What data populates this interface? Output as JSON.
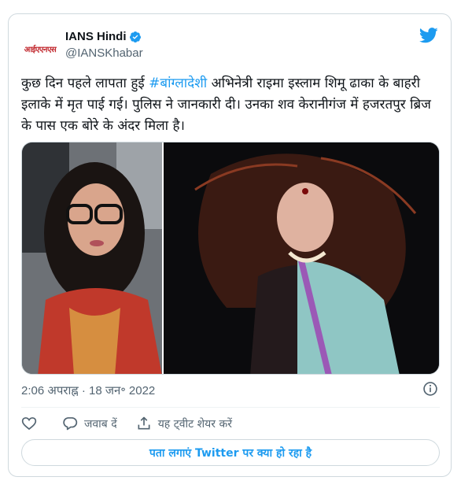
{
  "author": {
    "avatar_text": "आईएएनएस",
    "display_name": "IANS Hindi",
    "handle": "@IANSKhabar"
  },
  "tweet": {
    "text_before": "कुछ दिन पहले लापता हुई ",
    "hashtag": "#बांग्लादेशी",
    "text_after": " अभिनेत्री राइमा इस्लाम शिमू ढाका के बाहरी इलाके में मृत पाई गई। पुलिस ने जानकारी दी।  उनका शव केरानीगंज में हजरतपुर ब्रिज के पास एक बोरे के अंदर मिला है।"
  },
  "timestamp": "2:06 अपराह्न · 18 जन॰ 2022",
  "actions": {
    "reply_label": "जवाब दें",
    "share_label": "यह ट्वीट शेयर करें"
  },
  "cta_label": "पता लगाएं Twitter पर क्या हो रहा है",
  "colors": {
    "accent": "#1d9bf0",
    "text": "#0f1419",
    "muted": "#536471",
    "border": "#cfd9de",
    "avatar_text": "#c1272d"
  },
  "icons": [
    "verified-badge-icon",
    "twitter-bird-icon",
    "info-icon",
    "heart-icon",
    "reply-icon",
    "share-icon"
  ]
}
